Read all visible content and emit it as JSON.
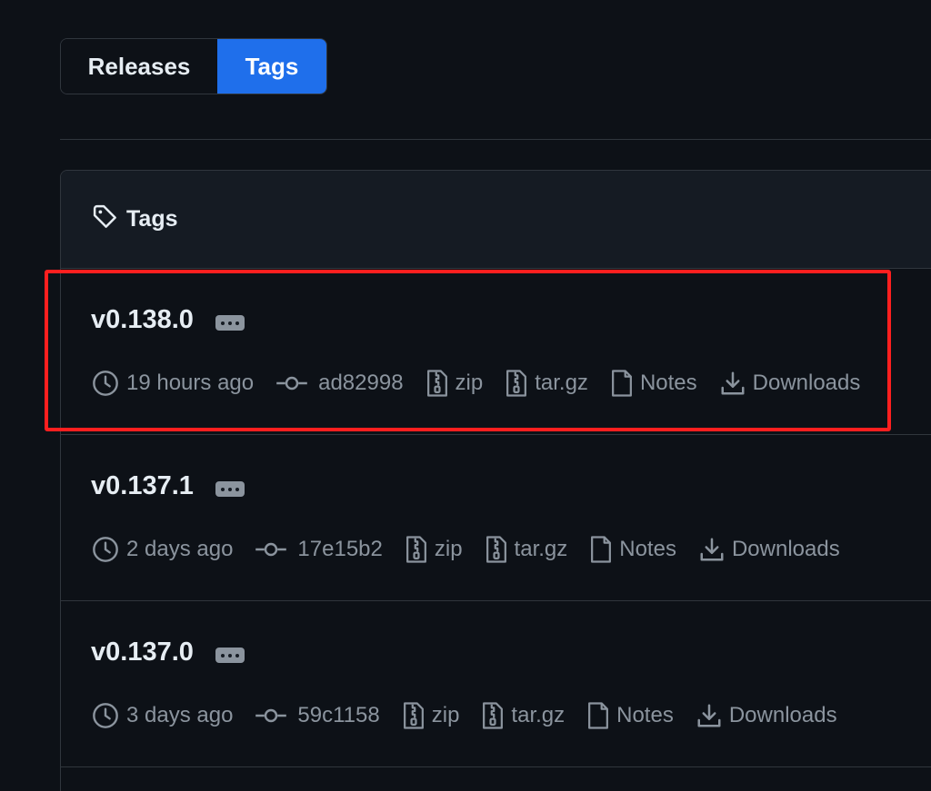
{
  "tabs": {
    "releases_label": "Releases",
    "tags_label": "Tags",
    "active": "Tags"
  },
  "box": {
    "header_title": "Tags"
  },
  "tags": [
    {
      "name": "v0.138.0",
      "time": "19 hours ago",
      "commit": "ad82998",
      "zip_label": "zip",
      "targz_label": "tar.gz",
      "notes_label": "Notes",
      "downloads_label": "Downloads"
    },
    {
      "name": "v0.137.1",
      "time": "2 days ago",
      "commit": "17e15b2",
      "zip_label": "zip",
      "targz_label": "tar.gz",
      "notes_label": "Notes",
      "downloads_label": "Downloads"
    },
    {
      "name": "v0.137.0",
      "time": "3 days ago",
      "commit": "59c1158",
      "zip_label": "zip",
      "targz_label": "tar.gz",
      "notes_label": "Notes",
      "downloads_label": "Downloads"
    }
  ],
  "colors": {
    "background": "#0d1117",
    "accent": "#1f6feb",
    "border": "#30363d",
    "muted_text": "#8b949e",
    "highlight": "#ff1f1f"
  },
  "icons": {
    "header": "tag-icon",
    "time": "clock-icon",
    "commit": "git-commit-icon",
    "zip": "file-zip-icon",
    "targz": "file-zip-icon",
    "notes": "file-icon",
    "downloads": "download-icon"
  }
}
